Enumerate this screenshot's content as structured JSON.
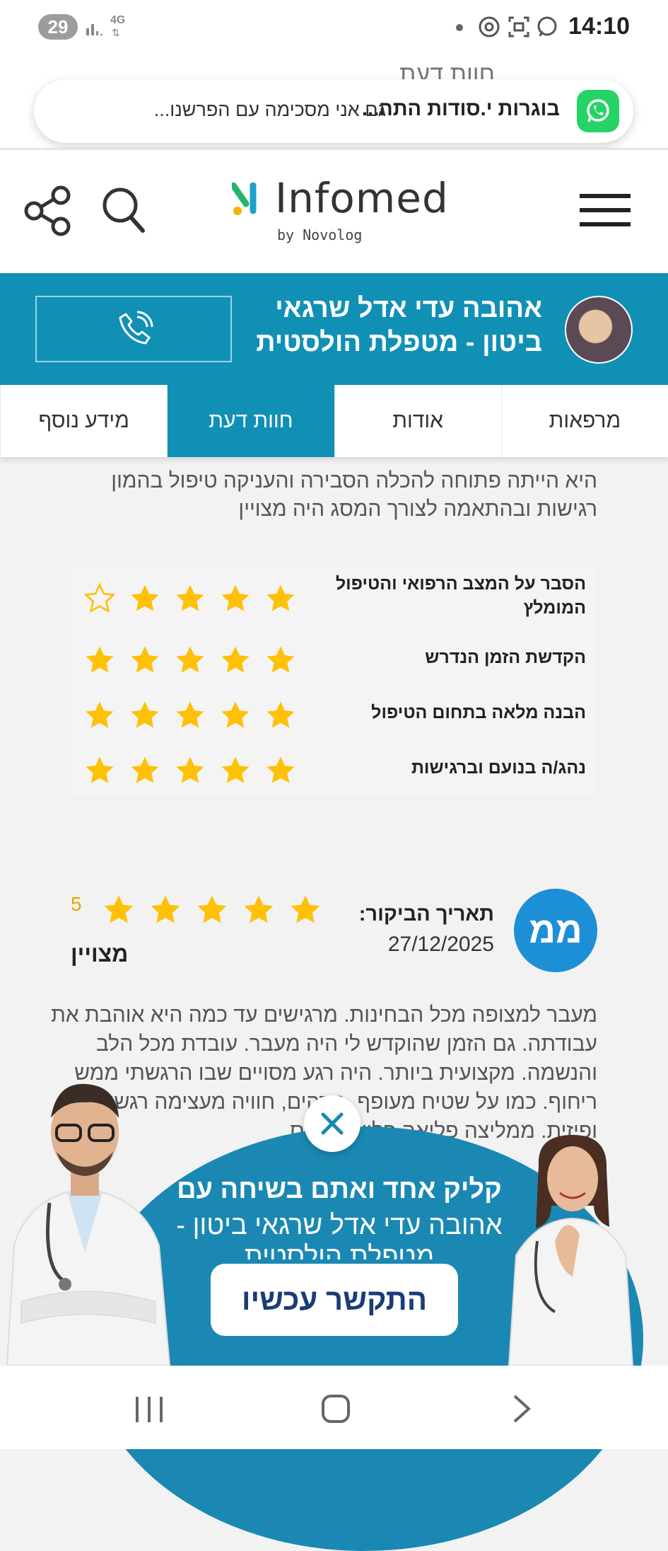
{
  "status_bar": {
    "notification_count": "29",
    "network": "4G",
    "time": "14:10"
  },
  "notification": {
    "ghost_text": "חוות דעת",
    "title": "בוגרות י.סודות התה...",
    "text": "גם אני מסכימה עם הפרשנו..."
  },
  "header": {
    "logo_word": "Infomed",
    "logo_by": "by Novolog"
  },
  "profile": {
    "name_line1": "אהובה עדי אדל שרגאי",
    "name_line2": "ביטון - מטפלת הולסטית"
  },
  "tabs": [
    {
      "label": "מרפאות",
      "active": false
    },
    {
      "label": "אודות",
      "active": false
    },
    {
      "label": "חוות דעת",
      "active": true
    },
    {
      "label": "מידע נוסף",
      "active": false
    }
  ],
  "previous_review": {
    "text": "היא הייתה פתוחה להכלה הסבירה והעניקה טיפול בהמון רגישות ובהתאמה לצורך המסג היה מצויין"
  },
  "ratings": [
    {
      "label": "הסבר על המצב הרפואי והטיפול המומלץ",
      "stars": 4
    },
    {
      "label": "הקדשת הזמן הנדרש",
      "stars": 5
    },
    {
      "label": "הבנה מלאה בתחום הטיפול",
      "stars": 5
    },
    {
      "label": "נהג/ה בנועם וברגישות",
      "stars": 5
    }
  ],
  "review": {
    "initials": "ממ",
    "date_label": "תאריך הביקור:",
    "date": "27/12/2025",
    "score": "5",
    "stars": 5,
    "level": "מצויין",
    "text": "מעבר למצופה מכל הבחינות. מרגישים עד כמה היא אוהבת את עבודתה. גם הזמן שהוקדש לי היה מעבר. עובדת מכל הלב והנשמה. מקצועית ביותר. היה רגע מסויים שבו הרגשתי ממש ריחוף. כמו על שטיח מעופף. מדהים, חוויה מעצימה רגשית ופיזית. ממליצה פליאה פליאה פלוס"
  },
  "banner": {
    "headline": "קליק אחד ואתם בשיחה עם",
    "subline": "אהובה עדי אדל שרגאי ביטון - מטפלת הולסטית",
    "cta": "התקשר עכשיו"
  },
  "colors": {
    "brand": "#1190b6",
    "star": "#ffc107",
    "whatsapp": "#25d366",
    "avatar_blue": "#1d8fd6"
  }
}
